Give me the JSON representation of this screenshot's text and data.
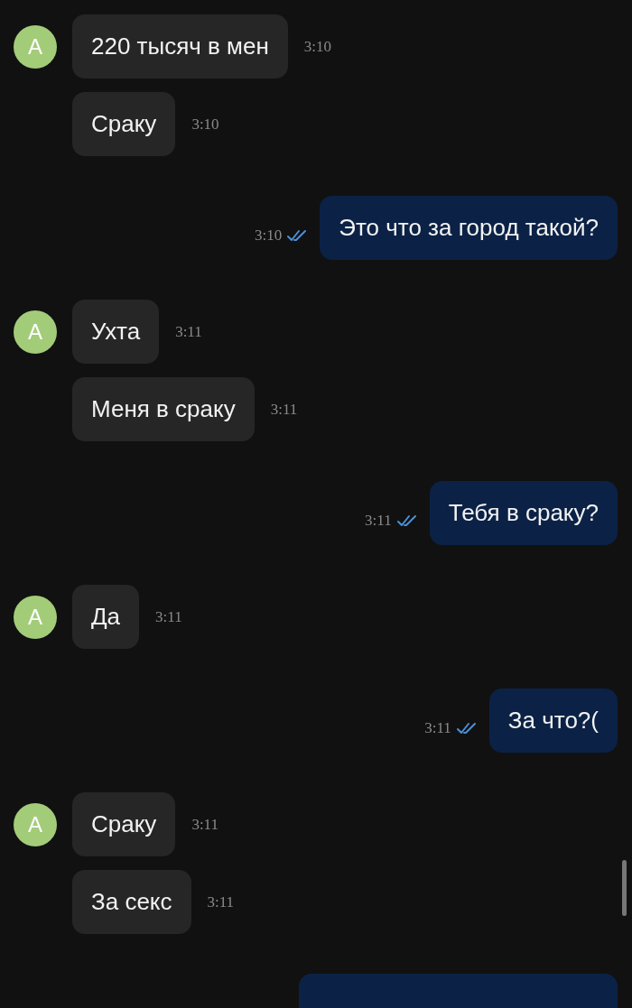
{
  "groups": [
    {
      "kind": "incoming",
      "avatar": "A",
      "messages": [
        {
          "text": "220 тысяч в мен",
          "time": "3:10"
        },
        {
          "text": "Сраку",
          "time": "3:10"
        }
      ]
    },
    {
      "kind": "outgoing",
      "messages": [
        {
          "text": "Это что за город такой?",
          "time": "3:10",
          "read": true
        }
      ]
    },
    {
      "kind": "incoming",
      "avatar": "A",
      "messages": [
        {
          "text": "Ухта",
          "time": "3:11"
        },
        {
          "text": "Меня в сраку",
          "time": "3:11"
        }
      ]
    },
    {
      "kind": "outgoing",
      "messages": [
        {
          "text": "Тебя в сраку?",
          "time": "3:11",
          "read": true
        }
      ]
    },
    {
      "kind": "incoming",
      "avatar": "A",
      "messages": [
        {
          "text": "Да",
          "time": "3:11"
        }
      ]
    },
    {
      "kind": "outgoing",
      "messages": [
        {
          "text": "За что?(",
          "time": "3:11",
          "read": true
        }
      ]
    },
    {
      "kind": "incoming",
      "avatar": "A",
      "messages": [
        {
          "text": "Сраку",
          "time": "3:11"
        },
        {
          "text": "За секс",
          "time": "3:11"
        }
      ]
    },
    {
      "kind": "outgoing",
      "messages": [
        {
          "truncated": true
        }
      ]
    }
  ]
}
